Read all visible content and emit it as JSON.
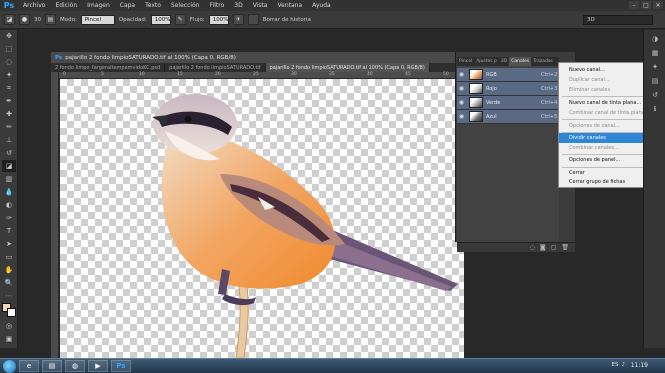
{
  "app": {
    "logo": "Ps"
  },
  "menubar": {
    "items": [
      "Archivo",
      "Edición",
      "Imagen",
      "Capa",
      "Texto",
      "Selección",
      "Filtro",
      "3D",
      "Vista",
      "Ventana",
      "Ayuda"
    ]
  },
  "options": {
    "mode_label": "Modo:",
    "mode_value": "Pincel",
    "opacity_label": "Opacidad:",
    "opacity_value": "100%",
    "flow_label": "Flujo:",
    "flow_value": "100%",
    "history_label": "Borrar de historia",
    "brush_size": "30",
    "workspace_value": "3D"
  },
  "document": {
    "title": "pajarillo 2 fondo limpioSATURADO.tif al 100% (Capa 0, RGB/8)",
    "tabs": [
      "2 fondo limpo_fargeraltempamvidoKC.psd",
      "pajarillo 2 fondo limpioSATURADO.tif",
      "pajarillo 2 fondo limpioSATURADO.tif al 100% (Capa 0, RGB/8)"
    ],
    "active_tab": 2,
    "ruler_ticks": [
      "0",
      "5",
      "10",
      "15",
      "20",
      "25",
      "30",
      "35",
      "40",
      "45",
      "50"
    ]
  },
  "panels": {
    "tabs": [
      "Pincel",
      "Ajustes p",
      "3D",
      "Canales",
      "Trazados"
    ],
    "active_tab": 3,
    "channels": [
      {
        "name": "RGB",
        "shortcut": "Ctrl+2",
        "selected": true
      },
      {
        "name": "Rojo",
        "shortcut": "Ctrl+3",
        "selected": true
      },
      {
        "name": "Verde",
        "shortcut": "Ctrl+4",
        "selected": true
      },
      {
        "name": "Azul",
        "shortcut": "Ctrl+5",
        "selected": true
      }
    ]
  },
  "context_menu": {
    "items": [
      {
        "label": "Nuevo canal...",
        "state": "enabled"
      },
      {
        "label": "Duplicar canal...",
        "state": "disabled"
      },
      {
        "label": "Eliminar canales",
        "state": "disabled"
      },
      {
        "label": "Nuevo canal de tinta plana...",
        "state": "enabled"
      },
      {
        "label": "Combinar canal de tinta plana",
        "state": "disabled"
      },
      {
        "label": "Opciones de canal...",
        "state": "disabled"
      },
      {
        "label": "Dividir canales",
        "state": "highlight"
      },
      {
        "label": "Combinar canales...",
        "state": "disabled"
      },
      {
        "label": "Opciones de panel...",
        "state": "enabled"
      },
      {
        "label": "Cerrar",
        "state": "enabled"
      },
      {
        "label": "Cerrar grupo de fichas",
        "state": "enabled"
      }
    ]
  },
  "taskbar": {
    "clock": "11:19",
    "tray": "ES"
  },
  "colors": {
    "accent": "#2f86d6",
    "channel_selected": "#5a6a85",
    "panel_bg": "#424242"
  }
}
